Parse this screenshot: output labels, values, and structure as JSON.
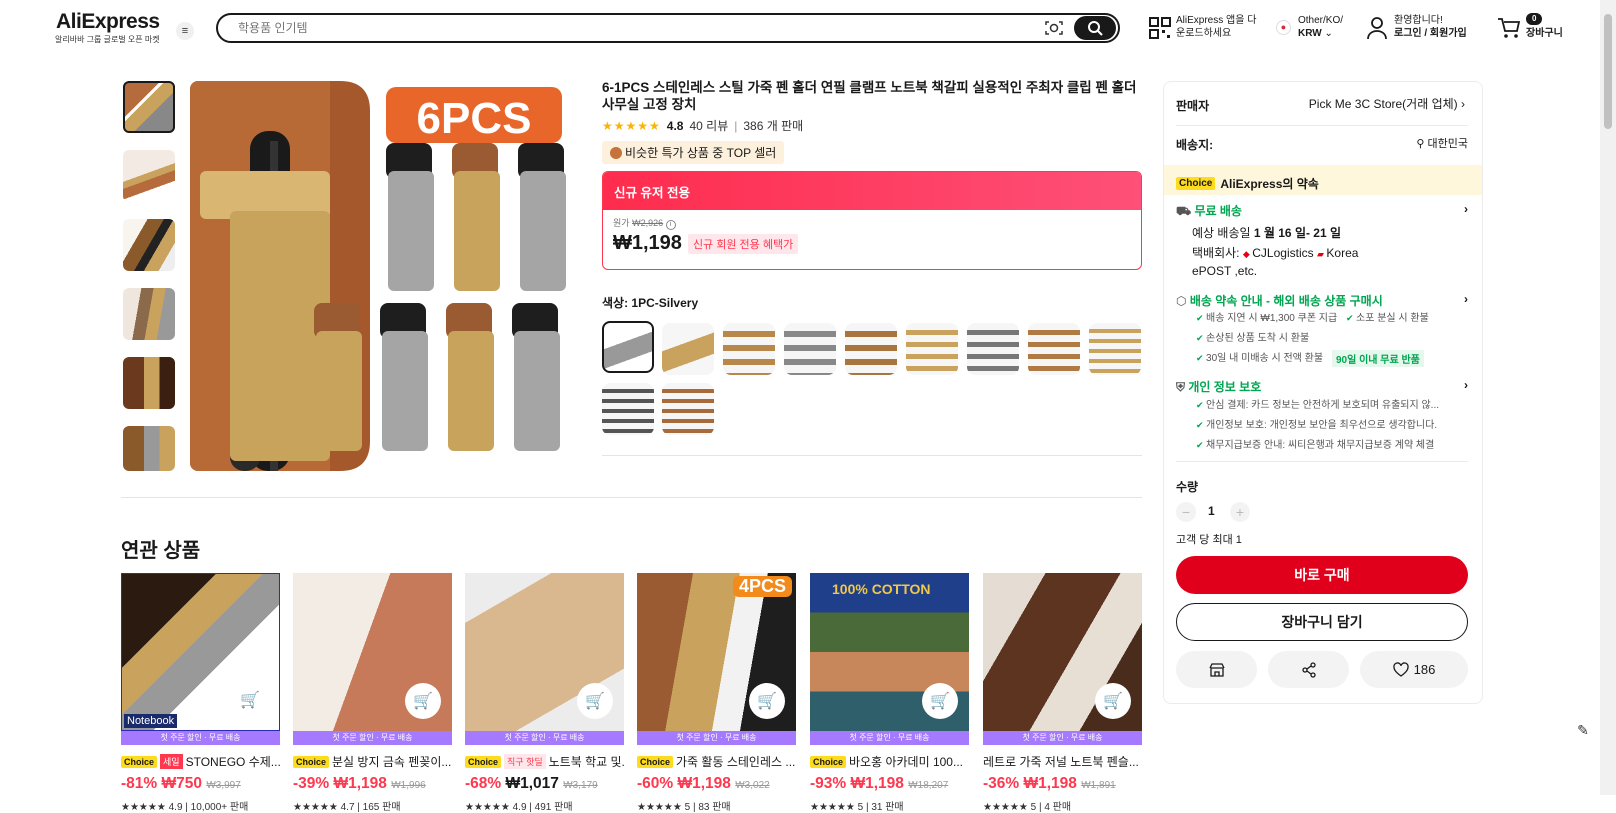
{
  "header": {
    "logo": "AliExpress",
    "logo_sub": "알리바바 그룹 글로벌 오픈 마켓",
    "search_placeholder": "학용품 인기템",
    "app_download": "AliExpress 앱을 다운로드하세요",
    "region": "Other/KO/",
    "currency": "KRW",
    "welcome": "환영합니다!",
    "login": "로그인 / 회원가입",
    "cart_count": "0",
    "cart_label": "장바구니"
  },
  "product": {
    "image_badge": "6PCS",
    "title": "6-1PCS 스테인레스 스틸 가죽 펜 홀더 연필 클램프 노트북 책갈피 실용적인 주최자 클립 펜 홀더 사무실 고정 장치",
    "rating": "4.8",
    "reviews": "40 리뷰",
    "sold": "386 개 판매",
    "top_seller": "비슷한 특가 상품 중 TOP 셀러",
    "price_header": "신규 유저 전용",
    "original_label": "원가",
    "original_price": "₩2,926",
    "price": "₩1,198",
    "price_tag": "신규 회원 전용 혜택가",
    "color_label": "색상: 1PC-Silvery"
  },
  "panel": {
    "seller_label": "판매자",
    "seller_value": "Pick Me 3C Store(거래 업체)",
    "ship_to_label": "배송지:",
    "ship_to_value": "대한민국",
    "choice_badge": "Choice",
    "promise": "AliExpress의 약속",
    "free_ship": "무료 배송",
    "eta_prefix": "예상 배송일 ",
    "eta": "1 월 16 일- 21 일",
    "carrier_label": "택배회사:",
    "carrier_1": "CJLogistics",
    "carrier_2": "Korea",
    "carrier_3": "ePOST ,etc.",
    "guide": "배송 약속 안내 - 해외 배송 상품 구매시",
    "checks1": [
      "배송 지연 시 ₩1,300 쿠폰 지급",
      "소포 분실 시 환불",
      "손상된 상품 도착 시 환불",
      "30일 내 미배송 시 전액 환불"
    ],
    "refund_badge": "90일 이내 무료 반품",
    "privacy": "개인 정보 보호",
    "checks2": [
      "안심 결제: 카드 정보는 안전하게 보호되며 유출되지 않...",
      "개인정보 보호: 개인정보 보안을 최우선으로 생각합니다.",
      "채무지급보증 안내: 씨티은행과 채무지급보증 계약 체결"
    ],
    "qty_label": "수량",
    "qty": "1",
    "max_per": "고객 당 최대 1",
    "buy_now": "바로 구매",
    "add_cart": "장바구니 담기",
    "wish_count": "186"
  },
  "related": {
    "title": "연관 상품",
    "items": [
      {
        "banner": "첫 주문 할인 · 무료 배송",
        "name": "STONEGO 수제...",
        "tag": "세일",
        "discount": "-81%",
        "price": "₩750",
        "orig": "₩3,997",
        "rating": "4.9",
        "sold": "10,000+ 판매",
        "overlay": "Notebook"
      },
      {
        "banner": "첫 주문 할인 · 무료 배송",
        "name": "분실 방지 금속 펜꽂이...",
        "tag": "",
        "discount": "-39%",
        "price": "₩1,198",
        "orig": "₩1,996",
        "rating": "4.7",
        "sold": "165 판매",
        "overlay": ""
      },
      {
        "banner": "첫 주문 할인 · 무료 배송",
        "name": "노트북 학교 및...",
        "tag": "직구 핫딜",
        "discount": "-68%",
        "price": "₩1,017",
        "orig": "₩3,179",
        "rating": "4.9",
        "sold": "491 판매",
        "overlay": ""
      },
      {
        "banner": "첫 주문 할인 · 무료 배송",
        "name": "가죽 활동 스테인레스 ...",
        "tag": "",
        "discount": "-60%",
        "price": "₩1,198",
        "orig": "₩3,022",
        "rating": "5",
        "sold": "83 판매",
        "overlay": "4PCS"
      },
      {
        "banner": "첫 주문 할인 · 무료 배송",
        "name": "바오홍 아카데미 100...",
        "tag": "",
        "discount": "-93%",
        "price": "₩1,198",
        "orig": "₩18,207",
        "rating": "5",
        "sold": "31 판매",
        "overlay": "100% COTTON"
      },
      {
        "banner": "첫 주문 할인 · 무료 배송",
        "name": "레트로 가죽 저널 노트북 펜슬...",
        "tag": "",
        "discount": "-36%",
        "price": "₩1,198",
        "orig": "₩1,891",
        "rating": "5",
        "sold": "4 판매",
        "overlay": ""
      }
    ]
  },
  "colors": {
    "red": "#fd384f",
    "buy": "#e0001b",
    "choice": "#fddc1d",
    "green": "#00a650"
  }
}
